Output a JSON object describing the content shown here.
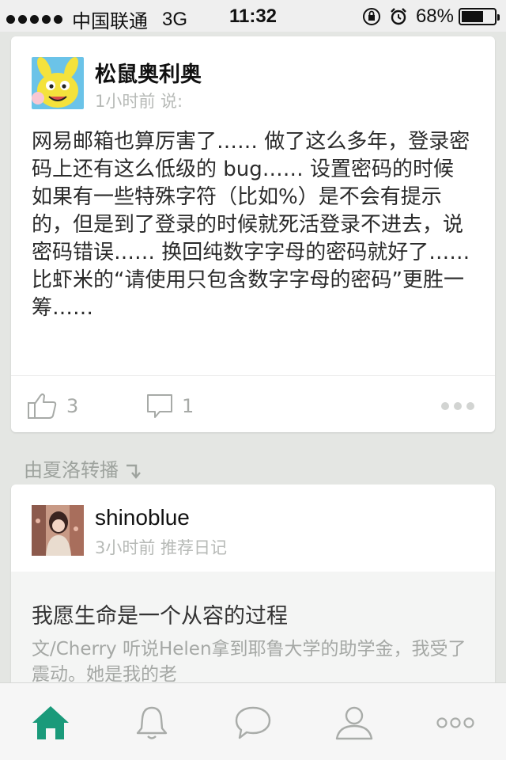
{
  "status_bar": {
    "carrier": "中国联通",
    "network": "3G",
    "time": "11:32",
    "battery": "68%",
    "battery_level": 0.68
  },
  "feed": [
    {
      "username": "松鼠奥利奥",
      "meta": "1小时前 说:",
      "text": "网易邮箱也算厉害了…… 做了这么多年，登录密码上还有这么低级的 bug…… 设置密码的时候如果有一些特殊字符（比如%）是不会有提示的，但是到了登录的时候就死活登录不进去，说密码错误…… 换回纯数字字母的密码就好了…… 比虾米的“请使用只包含数字字母的密码”更胜一筹……",
      "likes": "3",
      "comments": "1"
    }
  ],
  "repost_label": "由夏洛转播",
  "post2": {
    "username": "shinoblue",
    "meta": "3小时前 推荐日记",
    "diary_title": "我愿生命是一个从容的过程",
    "diary_excerpt": "文/Cherry 听说Helen拿到耶鲁大学的助学金，我受了震动。她是我的老"
  },
  "colors": {
    "accent": "#1a9a7a",
    "background": "#e4e6e3",
    "muted_text": "#b7bab7"
  },
  "tabs": [
    {
      "icon": "home-icon",
      "active": true
    },
    {
      "icon": "bell-icon",
      "active": false
    },
    {
      "icon": "chat-bubble-icon",
      "active": false
    },
    {
      "icon": "person-icon",
      "active": false
    },
    {
      "icon": "more-icon",
      "active": false
    }
  ]
}
